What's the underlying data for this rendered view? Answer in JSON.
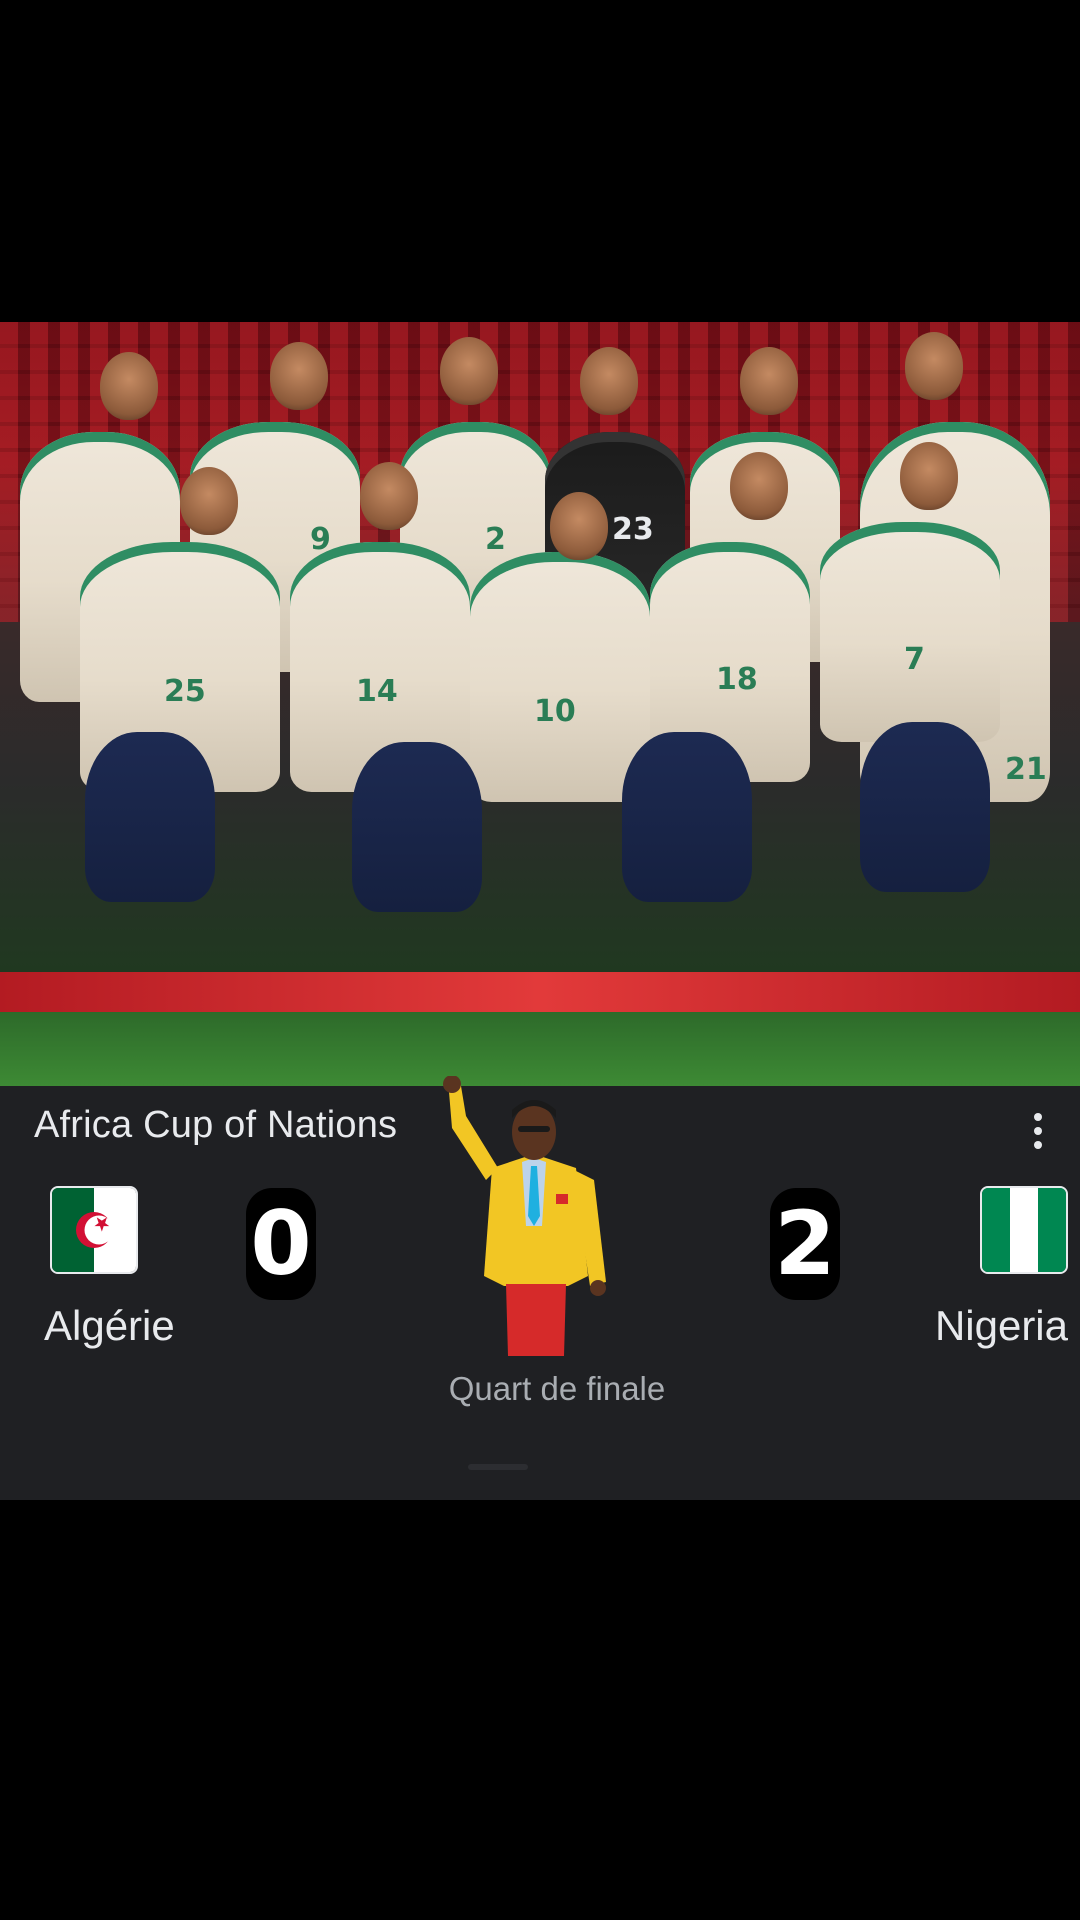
{
  "match": {
    "competition": "Africa Cup of Nations",
    "home": {
      "name": "Algérie",
      "score": "0",
      "flag_colors": [
        "#006233",
        "#ffffff",
        "#d21034"
      ]
    },
    "away": {
      "name": "Nigeria",
      "score": "2",
      "flag_colors": [
        "#008751",
        "#ffffff",
        "#008751"
      ]
    },
    "round": "Quart de finale"
  },
  "photo": {
    "jersey_numbers": [
      "25",
      "14",
      "10",
      "18",
      "7",
      "9",
      "2",
      "23",
      "21"
    ]
  },
  "colors": {
    "card_bg": "#1f2023",
    "text_primary": "#e8eaed",
    "text_secondary": "#a9adb2",
    "suit": "#f2c624",
    "trousers": "#d62a2a"
  }
}
